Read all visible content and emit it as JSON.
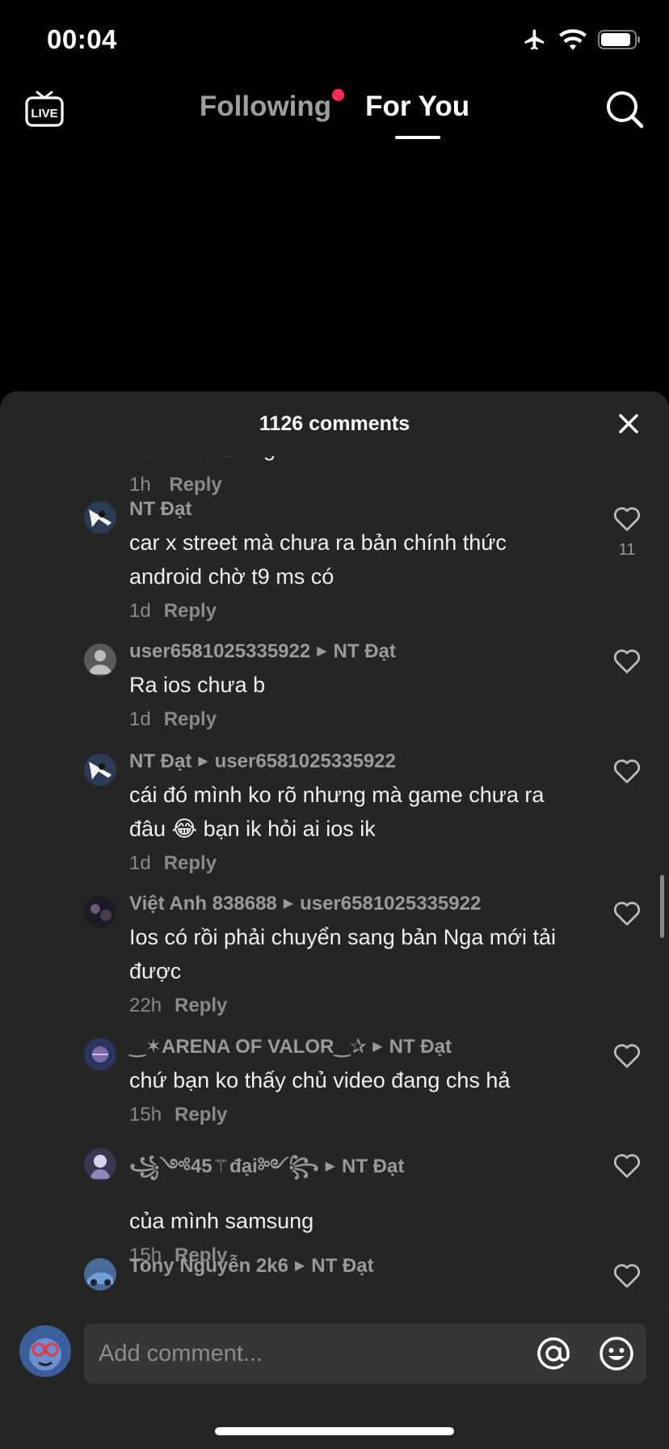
{
  "status_bar": {
    "time": "00:04",
    "icons": [
      "airplane-icon",
      "wifi-icon",
      "battery-icon"
    ]
  },
  "top_nav": {
    "live_icon": "live-tv-icon",
    "tabs": [
      {
        "label": "Following",
        "has_notification_dot": true,
        "active": false
      },
      {
        "label": "For You",
        "active": true
      }
    ],
    "search_icon": "search-icon"
  },
  "sheet": {
    "title": "1126 comments",
    "close_icon": "close-icon"
  },
  "partial_comment": {
    "text": "Tới l chờ tải ngừ",
    "time": "1h",
    "reply_label": "Reply"
  },
  "comments": [
    {
      "user": "NT Đạt",
      "reply_to": "",
      "text": "car x street mà chưa ra bản chính thức android chờ t9 ms có",
      "time": "1d",
      "reply_label": "Reply",
      "likes": "11"
    },
    {
      "user": "user6581025335922",
      "reply_to": "NT Đạt",
      "text": "Ra ios chưa b",
      "time": "1d",
      "reply_label": "Reply",
      "likes": ""
    },
    {
      "user": "NT Đạt",
      "reply_to": "user6581025335922",
      "text": "cái đó mình ko rõ nhưng mà game chưa ra đâu 😂 bạn ik hỏi ai ios ik",
      "time": "1d",
      "reply_label": "Reply",
      "likes": ""
    },
    {
      "user": "Việt Anh 838688",
      "reply_to": "user6581025335922",
      "text": "Ios có rồi phải chuyển sang bản Nga mới tải được",
      "time": "22h",
      "reply_label": "Reply",
      "likes": ""
    },
    {
      "user": "‿✶ARENA OF VALOR‿✰",
      "reply_to": "NT Đạt",
      "text": "chứ bạn ko thấy chủ video đang chs hả",
      "time": "15h",
      "reply_label": "Reply",
      "likes": ""
    },
    {
      "user": "꧁༺45⚚đại༻꧂",
      "reply_to": "NT Đạt",
      "text": "của mình samsung",
      "time": "15h",
      "reply_label": "Reply",
      "likes": ""
    },
    {
      "user": "Tony Nguyễn 2k6",
      "reply_to": "NT Đạt",
      "text": "",
      "time": "",
      "reply_label": "",
      "likes": ""
    }
  ],
  "input_bar": {
    "placeholder": "Add comment...",
    "at_icon": "at-mention-icon",
    "emoji_icon": "emoji-icon"
  },
  "colors": {
    "accent": "#fe2c55",
    "sheet_bg": "#252525",
    "input_bg": "#363636"
  }
}
